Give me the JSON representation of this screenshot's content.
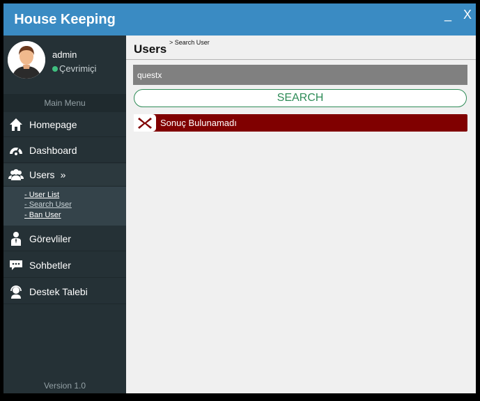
{
  "window": {
    "title": "House Keeping",
    "minimize_label": "_",
    "close_label": "X"
  },
  "sidebar": {
    "user": {
      "name": "admin",
      "status": "Çevrimiçi"
    },
    "menu_header": "Main Menu",
    "items": [
      {
        "label": "Homepage",
        "icon": "home-icon"
      },
      {
        "label": "Dashboard",
        "icon": "dashboard-icon"
      },
      {
        "label": "Users",
        "icon": "users-icon",
        "expander": "»"
      },
      {
        "label": "Görevliler",
        "icon": "staff-icon"
      },
      {
        "label": "Sohbetler",
        "icon": "chat-icon"
      },
      {
        "label": "Destek Talebi",
        "icon": "support-icon"
      }
    ],
    "submenu": [
      {
        "label": "- User List"
      },
      {
        "label": "- Search User"
      },
      {
        "label": "- Ban User"
      }
    ],
    "version": "Version 1.0"
  },
  "main": {
    "title": "Users",
    "breadcrumb": "> Search User",
    "search": {
      "value": "questx",
      "button_label": "SEARCH"
    },
    "result_message": "Sonuç Bulunamadı"
  },
  "colors": {
    "brand": "#3a8bc3",
    "sidebar": "#253136",
    "error": "#800000",
    "accent_green": "#2e8b57",
    "online": "#3fbf7f"
  }
}
